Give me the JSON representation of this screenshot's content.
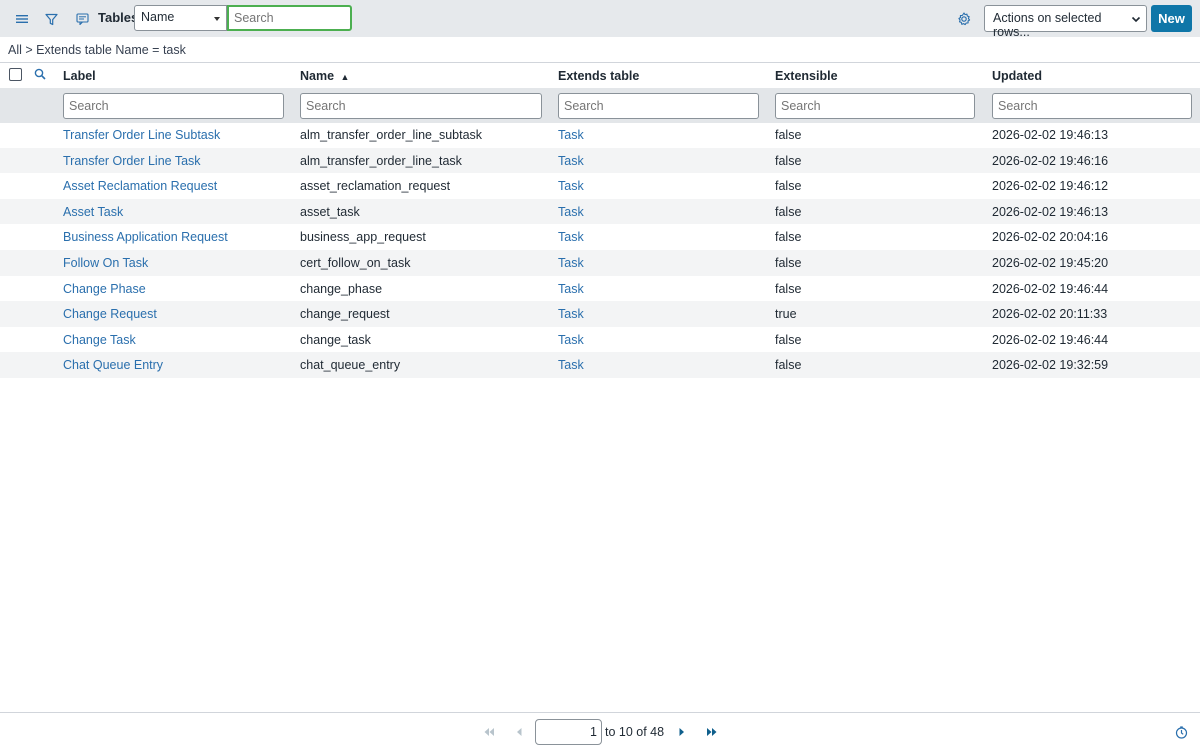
{
  "header": {
    "title": "Tables",
    "field_select_value": "Name",
    "search_placeholder": "Search",
    "actions_label": "Actions on selected rows...",
    "new_label": "New"
  },
  "breadcrumb": "All > Extends table Name = task",
  "columns": [
    "Label",
    "Name",
    "Extends table",
    "Extensible",
    "Updated"
  ],
  "sort_indicator": "▲",
  "filter_placeholder": "Search",
  "rows": [
    {
      "label": "Transfer Order Line Subtask",
      "name": "alm_transfer_order_line_subtask",
      "extends": "Task",
      "extensible": "false",
      "updated": "2026-02-02 19:46:13"
    },
    {
      "label": "Transfer Order Line Task",
      "name": "alm_transfer_order_line_task",
      "extends": "Task",
      "extensible": "false",
      "updated": "2026-02-02 19:46:16"
    },
    {
      "label": "Asset Reclamation Request",
      "name": "asset_reclamation_request",
      "extends": "Task",
      "extensible": "false",
      "updated": "2026-02-02 19:46:12"
    },
    {
      "label": "Asset Task",
      "name": "asset_task",
      "extends": "Task",
      "extensible": "false",
      "updated": "2026-02-02 19:46:13"
    },
    {
      "label": "Business Application Request",
      "name": "business_app_request",
      "extends": "Task",
      "extensible": "false",
      "updated": "2026-02-02 20:04:16"
    },
    {
      "label": "Follow On Task",
      "name": "cert_follow_on_task",
      "extends": "Task",
      "extensible": "false",
      "updated": "2026-02-02 19:45:20"
    },
    {
      "label": "Change Phase",
      "name": "change_phase",
      "extends": "Task",
      "extensible": "false",
      "updated": "2026-02-02 19:46:44"
    },
    {
      "label": "Change Request",
      "name": "change_request",
      "extends": "Task",
      "extensible": "true",
      "updated": "2026-02-02 20:11:33"
    },
    {
      "label": "Change Task",
      "name": "change_task",
      "extends": "Task",
      "extensible": "false",
      "updated": "2026-02-02 19:46:44"
    },
    {
      "label": "Chat Queue Entry",
      "name": "chat_queue_entry",
      "extends": "Task",
      "extensible": "false",
      "updated": "2026-02-02 19:32:59"
    }
  ],
  "pagination": {
    "current": "1",
    "text": "to 10 of 48"
  },
  "colors": {
    "accent": "#0f76a8",
    "link": "#2a6fad",
    "header_bg": "#e6e9ec",
    "search_focus": "#4caf50"
  }
}
